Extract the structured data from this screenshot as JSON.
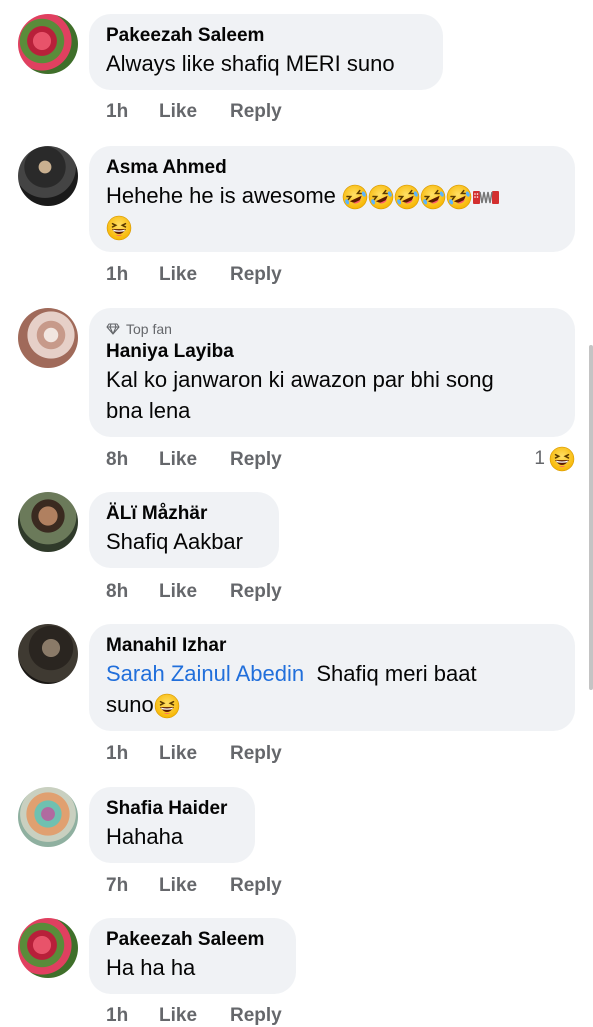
{
  "comments": [
    {
      "name": "Pakeezah Saleem",
      "text": "Always like shafiq MERI suno",
      "time": "1h",
      "like": "Like",
      "reply": "Reply"
    },
    {
      "name": "Asma Ahmed",
      "text": "Hehehe he is awesome",
      "time": "1h",
      "like": "Like",
      "reply": "Reply"
    },
    {
      "badge": "Top fan",
      "name": "Haniya Layiba",
      "text_line1": "Kal ko janwaron ki awazon par bhi song",
      "text_line2": "bna  lena",
      "time": "8h",
      "like": "Like",
      "reply": "Reply",
      "reaction_count": "1"
    },
    {
      "name": "ÄLï Måzhär",
      "text": "Shafiq Aakbar",
      "time": "8h",
      "like": "Like",
      "reply": "Reply"
    },
    {
      "name": "Manahil Izhar",
      "mention": "Sarah Zainul Abedin",
      "text_after": "Shafiq meri baat",
      "text_line2": "suno",
      "time": "1h",
      "like": "Like",
      "reply": "Reply"
    },
    {
      "name": "Shafia Haider",
      "text": "Hahaha",
      "time": "7h",
      "like": "Like",
      "reply": "Reply"
    },
    {
      "name": "Pakeezah Saleem",
      "text": "Ha ha ha",
      "time": "1h",
      "like": "Like",
      "reply": "Reply"
    }
  ],
  "icons": {
    "laugh": "rolling-on-floor-laughing-emoji",
    "grin": "grinning-squinting-emoji",
    "accordion": "accordion-emoji",
    "badge": "diamond-badge-icon",
    "haha": "haha-reaction-icon"
  }
}
